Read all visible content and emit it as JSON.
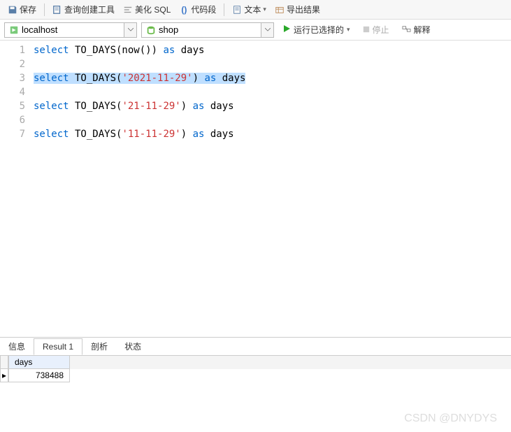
{
  "toolbar": {
    "save": "保存",
    "query_tool": "查询创建工具",
    "beautify": "美化 SQL",
    "code_snippet": "代码段",
    "text": "文本",
    "export": "导出结果"
  },
  "connection": {
    "host": "localhost",
    "database": "shop"
  },
  "actions": {
    "run_selected": "运行已选择的",
    "stop": "停止",
    "explain": "解释"
  },
  "editor": {
    "lines": [
      {
        "n": "1",
        "tokens": [
          {
            "t": "select",
            "c": "kw"
          },
          {
            "t": " TO_DAYS(now()) "
          },
          {
            "t": "as",
            "c": "kw"
          },
          {
            "t": " days"
          }
        ]
      },
      {
        "n": "2",
        "tokens": []
      },
      {
        "n": "3",
        "sel": true,
        "tokens": [
          {
            "t": "select",
            "c": "kw"
          },
          {
            "t": " TO_DAYS("
          },
          {
            "t": "'2021-11-29'",
            "c": "str"
          },
          {
            "t": ") "
          },
          {
            "t": "as",
            "c": "kw"
          },
          {
            "t": " days"
          }
        ]
      },
      {
        "n": "4",
        "tokens": []
      },
      {
        "n": "5",
        "tokens": [
          {
            "t": "select",
            "c": "kw"
          },
          {
            "t": " TO_DAYS("
          },
          {
            "t": "'21-11-29'",
            "c": "str"
          },
          {
            "t": ") "
          },
          {
            "t": "as",
            "c": "kw"
          },
          {
            "t": " days"
          }
        ]
      },
      {
        "n": "6",
        "tokens": []
      },
      {
        "n": "7",
        "tokens": [
          {
            "t": "select",
            "c": "kw"
          },
          {
            "t": " TO_DAYS("
          },
          {
            "t": "'11-11-29'",
            "c": "str"
          },
          {
            "t": ") "
          },
          {
            "t": "as",
            "c": "kw"
          },
          {
            "t": " days"
          }
        ]
      }
    ]
  },
  "tabs": {
    "info": "信息",
    "result": "Result 1",
    "profile": "剖析",
    "status": "状态"
  },
  "result": {
    "header": "days",
    "row_marker": "▸",
    "value": "738488"
  },
  "watermark": "CSDN @DNYDYS"
}
